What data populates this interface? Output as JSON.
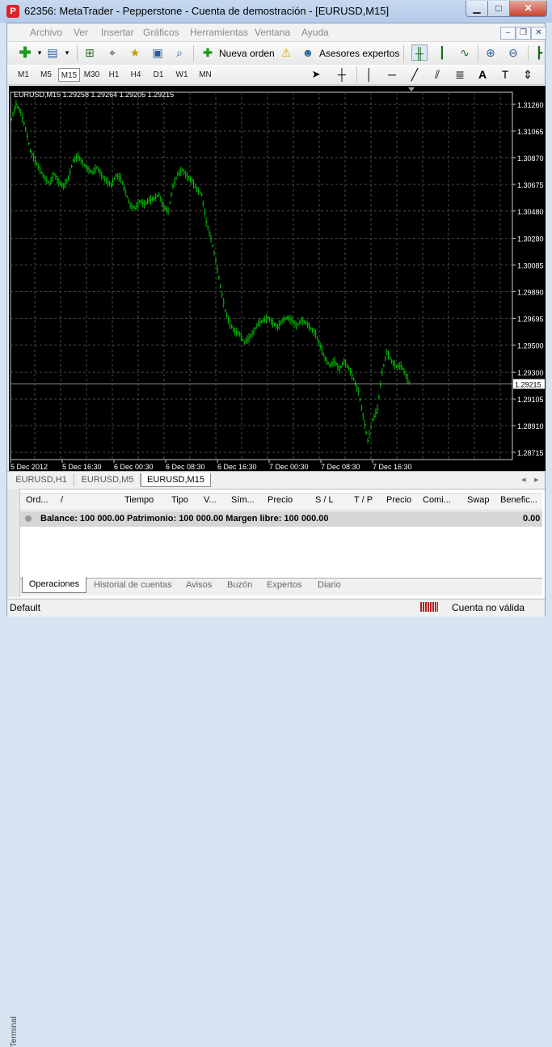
{
  "window": {
    "title": "62356: MetaTrader - Pepperstone - Cuenta de demostración - [EURUSD,M15]",
    "app_icon_letter": "P",
    "min_glyph": "▁",
    "max_glyph": "□",
    "close_glyph": "✕"
  },
  "menu": {
    "items": [
      "Archivo",
      "Ver",
      "Insertar",
      "Gráficos",
      "Herramientas",
      "Ventana",
      "Ayuda"
    ],
    "mdi_min": "–",
    "mdi_restore": "❐",
    "mdi_close": "✕"
  },
  "toolbar": {
    "new_order": "Nueva orden",
    "expert_advisors": "Asesores expertos"
  },
  "timeframes": {
    "items": [
      "M1",
      "M5",
      "M15",
      "M30",
      "H1",
      "H4",
      "D1",
      "W1",
      "MN"
    ],
    "active": "M15"
  },
  "chart": {
    "info": "EURUSD,M15  1.29258 1.29264 1.29205 1.29215",
    "current_price": "1.29215",
    "background": "#000000",
    "candle_color": "#00c000",
    "grid_color": "#4a4a4a"
  },
  "chart_data": {
    "type": "bar",
    "symbol": "EURUSD",
    "timeframe": "M15",
    "y_ticks": [
      1.3126,
      1.31065,
      1.3087,
      1.30675,
      1.3048,
      1.3028,
      1.30085,
      1.2989,
      1.29695,
      1.295,
      1.293,
      1.29105,
      1.2891,
      1.28715
    ],
    "ylim": [
      1.28715,
      1.3126
    ],
    "x_tick_labels": [
      "5 Dec 2012",
      "5 Dec 16:30",
      "6 Dec 00:30",
      "6 Dec 08:30",
      "6 Dec 16:30",
      "7 Dec 00:30",
      "7 Dec 08:30",
      "7 Dec 16:30"
    ],
    "last_price": 1.29215,
    "approx_close": [
      1.3115,
      1.3126,
      1.312,
      1.3108,
      1.3092,
      1.3085,
      1.3078,
      1.3072,
      1.3068,
      1.3075,
      1.3069,
      1.3066,
      1.3072,
      1.3085,
      1.3088,
      1.3083,
      1.3079,
      1.3076,
      1.308,
      1.3074,
      1.307,
      1.3067,
      1.3074,
      1.3072,
      1.3062,
      1.3052,
      1.305,
      1.3055,
      1.3053,
      1.3056,
      1.3057,
      1.306,
      1.3051,
      1.3048,
      1.3066,
      1.3075,
      1.3078,
      1.3073,
      1.307,
      1.3064,
      1.306,
      1.304,
      1.3028,
      1.3012,
      1.2993,
      1.2975,
      1.2965,
      1.296,
      1.2958,
      1.2952,
      1.2955,
      1.296,
      1.2966,
      1.2968,
      1.297,
      1.2966,
      1.2963,
      1.2968,
      1.297,
      1.2968,
      1.2964,
      1.2968,
      1.2966,
      1.2962,
      1.2958,
      1.2949,
      1.294,
      1.2935,
      1.2938,
      1.2932,
      1.2938,
      1.2933,
      1.2925,
      1.2916,
      1.2898,
      1.288,
      1.2895,
      1.2903,
      1.293,
      1.2945,
      1.2938,
      1.2934,
      1.2935,
      1.2928,
      1.292
    ]
  },
  "chart_tabs": {
    "items": [
      "EURUSD,H1",
      "EURUSD,M5",
      "EURUSD,M15"
    ],
    "active": "EURUSD,M15",
    "nav_left": "◂",
    "nav_right": "▸"
  },
  "terminal": {
    "side_label": "Terminal",
    "columns": [
      "Ord...",
      "/",
      "Tiempo",
      "Tipo",
      "V...",
      "Sím...",
      "Precio",
      "S / L",
      "T / P",
      "Precio",
      "Comi...",
      "Swap",
      "Benefic..."
    ],
    "balance_text": "Balance: 100 000.00  Patrimonio: 100 000.00  Margen libre: 100 000.00",
    "balance_value": "0.00",
    "tabs": [
      "Operaciones",
      "Historial de cuentas",
      "Avisos",
      "Buzón",
      "Expertos",
      "Diario"
    ],
    "active_tab": "Operaciones"
  },
  "status": {
    "profile": "Default",
    "connection": "Cuenta no válida"
  },
  "icons": {
    "new_chart": "plus-icon",
    "profiles": "window-icon",
    "market_watch": "market-icon",
    "navigator": "crosshair-icon",
    "terminal": "terminal-icon",
    "tester": "tester-icon",
    "new_order": "new-order-icon",
    "autotrading": "warning-icon",
    "zoom_in": "zoom-in-icon",
    "zoom_out": "zoom-out-icon"
  }
}
